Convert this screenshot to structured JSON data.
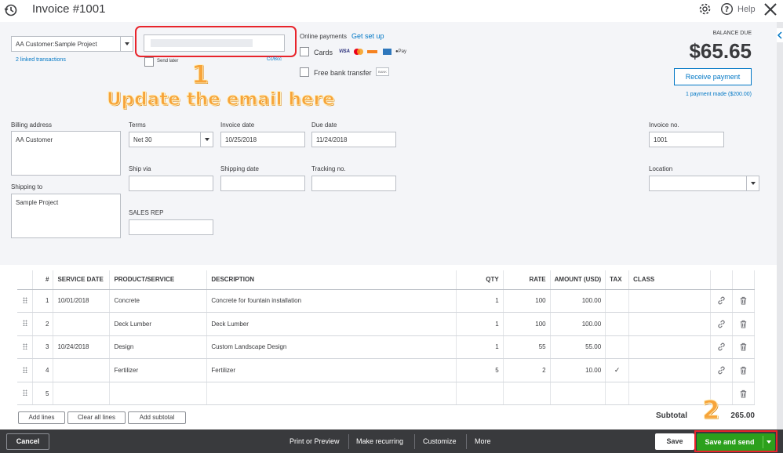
{
  "header": {
    "title": "Invoice #1001",
    "help_label": "Help"
  },
  "customer": {
    "value": "AA Customer:Sample Project",
    "linked": "2 linked transactions"
  },
  "email": {
    "send_later": "Send later",
    "cc_bcc": "Cc/Bcc"
  },
  "online_payments": {
    "label": "Online payments",
    "setup_link": "Get set up",
    "cards": "Cards",
    "bank_transfer": "Free bank transfer",
    "bank_badge": "BANK"
  },
  "annotations": {
    "step1": "1",
    "step1_text": "Update the email here",
    "step2": "2"
  },
  "balance": {
    "label": "BALANCE DUE",
    "value": "$65.65",
    "receive_payment": "Receive payment",
    "payment_made": "1 payment made ($200.00)"
  },
  "billing": {
    "label": "Billing address",
    "value": "AA Customer",
    "shipping_label": "Shipping to",
    "shipping_value": "Sample Project"
  },
  "terms": {
    "label": "Terms",
    "value": "Net 30"
  },
  "invoice_date": {
    "label": "Invoice date",
    "value": "10/25/2018"
  },
  "due_date": {
    "label": "Due date",
    "value": "11/24/2018"
  },
  "invoice_no": {
    "label": "Invoice no.",
    "value": "1001"
  },
  "ship_via": {
    "label": "Ship via",
    "value": ""
  },
  "shipping_date": {
    "label": "Shipping date",
    "value": ""
  },
  "tracking_no": {
    "label": "Tracking no.",
    "value": ""
  },
  "location": {
    "label": "Location",
    "value": ""
  },
  "sales_rep": {
    "label": "SALES REP",
    "value": ""
  },
  "table": {
    "headers": [
      "#",
      "SERVICE DATE",
      "PRODUCT/SERVICE",
      "DESCRIPTION",
      "QTY",
      "RATE",
      "AMOUNT (USD)",
      "TAX",
      "CLASS"
    ],
    "rows": [
      {
        "n": "1",
        "date": "10/01/2018",
        "product": "Concrete",
        "desc": "Concrete for fountain installation",
        "qty": "1",
        "rate": "100",
        "amount": "100.00",
        "tax": ""
      },
      {
        "n": "2",
        "date": "",
        "product": "Deck Lumber",
        "desc": "Deck Lumber",
        "qty": "1",
        "rate": "100",
        "amount": "100.00",
        "tax": ""
      },
      {
        "n": "3",
        "date": "10/24/2018",
        "product": "Design",
        "desc": "Custom Landscape Design",
        "qty": "1",
        "rate": "55",
        "amount": "55.00",
        "tax": ""
      },
      {
        "n": "4",
        "date": "",
        "product": "Fertilizer",
        "desc": "Fertilizer",
        "qty": "5",
        "rate": "2",
        "amount": "10.00",
        "tax": "✓"
      },
      {
        "n": "5",
        "date": "",
        "product": "",
        "desc": "",
        "qty": "",
        "rate": "",
        "amount": "",
        "tax": ""
      }
    ]
  },
  "line_buttons": {
    "add_lines": "Add lines",
    "clear_lines": "Clear all lines",
    "add_subtotal": "Add subtotal"
  },
  "subtotal": {
    "label": "Subtotal",
    "value": "265.00"
  },
  "footer": {
    "cancel": "Cancel",
    "print_preview": "Print or Preview",
    "make_recurring": "Make recurring",
    "customize": "Customize",
    "more": "More",
    "save": "Save",
    "save_and_send": "Save and send"
  },
  "colors": {
    "accent_green": "#2ca01c",
    "link_blue": "#0077c5",
    "highlight_red": "#e8242b",
    "annotation_orange": "#f7a43a"
  }
}
